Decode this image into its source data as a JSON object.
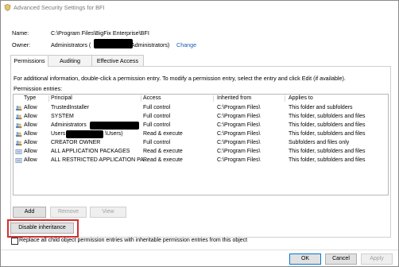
{
  "window": {
    "title_prefix": "Advanced Security Settings for ",
    "title_path": "BFI"
  },
  "props": {
    "name_label": "Name:",
    "name_value": "C:\\Program Files\\BigFix Enterprise\\BFI",
    "owner_label": "Owner:",
    "owner_prefix": "Administrators (",
    "owner_suffix": "\\Administrators)",
    "change_link": "Change"
  },
  "tabs": [
    "Permissions",
    "Auditing",
    "Effective Access"
  ],
  "info_text": "For additional information, double-click a permission entry. To modify a permission entry, select the entry and click Edit (if available).",
  "entries_label": "Permission entries:",
  "columns": [
    "Type",
    "Principal",
    "Access",
    "Inherited from",
    "Applies to"
  ],
  "rows": [
    {
      "type": "Allow",
      "principal": "TrustedInstaller",
      "access": "Full control",
      "inherited": "C:\\Program Files\\",
      "applies": "This folder and subfolders"
    },
    {
      "type": "Allow",
      "principal": "SYSTEM",
      "access": "Full control",
      "inherited": "C:\\Program Files\\",
      "applies": "This folder, subfolders and files"
    },
    {
      "type": "Allow",
      "principal": "Administrators",
      "access": "Full control",
      "inherited": "C:\\Program Files\\",
      "applies": "This folder, subfolders and files"
    },
    {
      "type": "Allow",
      "principal": "Users",
      "principal_suffix": "\\Users)",
      "access": "Read & execute",
      "inherited": "C:\\Program Files\\",
      "applies": "This folder, subfolders and files"
    },
    {
      "type": "Allow",
      "principal": "CREATOR OWNER",
      "access": "Full control",
      "inherited": "C:\\Program Files\\",
      "applies": "Subfolders and files only"
    },
    {
      "type": "Allow",
      "principal": "ALL APPLICATION PACKAGES",
      "access": "Read & execute",
      "inherited": "C:\\Program Files\\",
      "applies": "This folder, subfolders and files"
    },
    {
      "type": "Allow",
      "principal": "ALL RESTRICTED APPLICATION PA...",
      "access": "Read & execute",
      "inherited": "C:\\Program Files\\",
      "applies": "This folder, subfolders and files"
    }
  ],
  "buttons": {
    "add": "Add",
    "remove": "Remove",
    "view": "View",
    "disable_inheritance": "Disable inheritance",
    "ok": "OK",
    "cancel": "Cancel",
    "apply": "Apply"
  },
  "replace_checkbox_label": "Replace all child object permission entries with inheritable permission entries from this object",
  "colors": {
    "highlight": "#d32f2f",
    "link": "#1a5bb8"
  }
}
